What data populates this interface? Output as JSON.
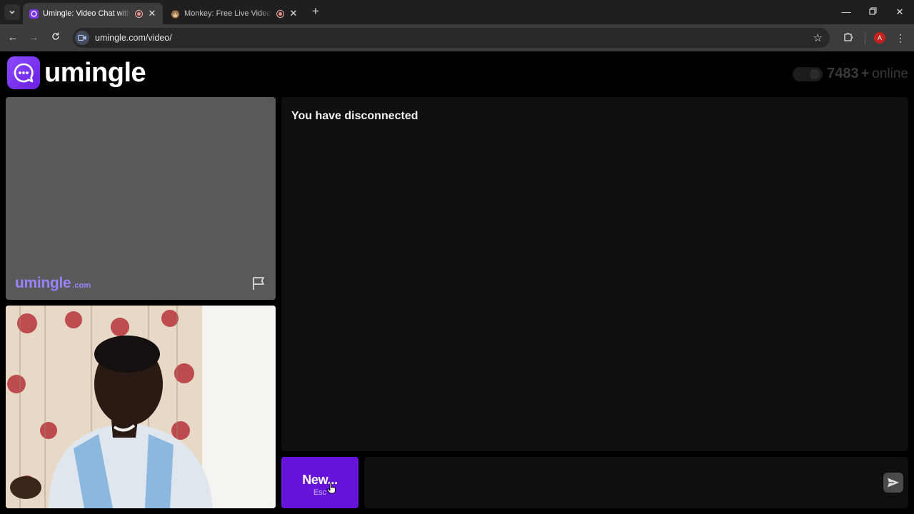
{
  "browser": {
    "tabs": [
      {
        "title": "Umingle: Video Chat with Strangers",
        "active": true
      },
      {
        "title": "Monkey: Free Live Video Chat",
        "active": false
      }
    ],
    "url": "umingle.com/video/",
    "profile_initial": "A"
  },
  "header": {
    "logo_text": "umingle",
    "online_count": "7483",
    "online_plus": "+",
    "online_label": "online"
  },
  "stranger_video": {
    "watermark": "umingle",
    "watermark_suffix": ".com"
  },
  "chat": {
    "status": "You have disconnected"
  },
  "controls": {
    "new_label": "New...",
    "new_shortcut": "Esc"
  },
  "colors": {
    "accent": "#6614d9",
    "logo_gradient_start": "#8d4bff",
    "watermark": "#9b83ff"
  }
}
